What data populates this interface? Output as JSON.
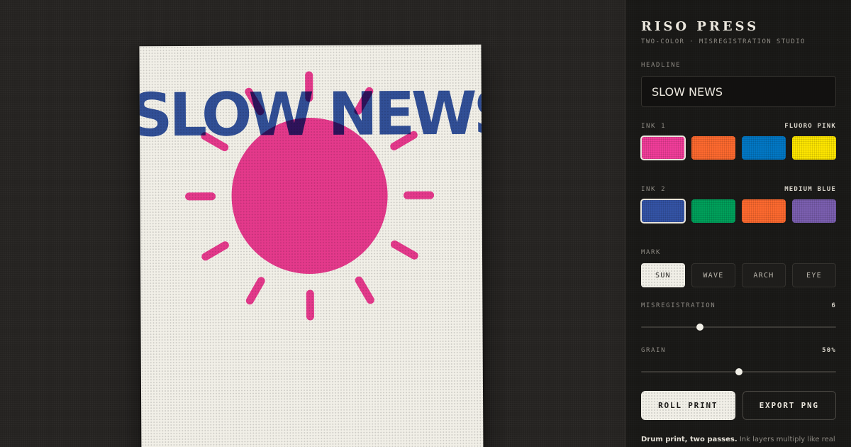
{
  "app": {
    "title": "RISO PRESS",
    "subtitle": "TWO-COLOR · MISREGISTRATION STUDIO"
  },
  "poster": {
    "headline_text": "SLOW NEWS",
    "mark_icon": "sun-icon"
  },
  "controls": {
    "headline": {
      "label": "HEADLINE",
      "value": "SLOW NEWS"
    },
    "ink1": {
      "label": "INK 1",
      "selected_name": "FLUORO PINK",
      "selected_index": 0,
      "swatches": [
        {
          "name": "fluoro-pink",
          "color": "#f23d9a"
        },
        {
          "name": "orange",
          "color": "#ff6a2f"
        },
        {
          "name": "blue",
          "color": "#0278c5"
        },
        {
          "name": "yellow",
          "color": "#ffe600"
        }
      ]
    },
    "ink2": {
      "label": "INK 2",
      "selected_name": "MEDIUM BLUE",
      "selected_index": 0,
      "swatches": [
        {
          "name": "medium-blue",
          "color": "#3454a6"
        },
        {
          "name": "green",
          "color": "#00a15b"
        },
        {
          "name": "orange",
          "color": "#ff6a2f"
        },
        {
          "name": "violet",
          "color": "#7b5fb0"
        }
      ]
    },
    "mark": {
      "label": "MARK",
      "active": "SUN",
      "options": [
        "SUN",
        "WAVE",
        "ARCH",
        "EYE"
      ]
    },
    "misregistration": {
      "label": "MISREGISTRATION",
      "value": 6,
      "display": "6",
      "min": 0,
      "max": 20
    },
    "grain": {
      "label": "GRAIN",
      "value": 50,
      "display": "50%",
      "min": 0,
      "max": 100
    },
    "roll_print_label": "ROLL PRINT",
    "export_label": "EXPORT PNG",
    "note_strong": "Drum print, two passes.",
    "note_text": " Ink layers multiply like real"
  }
}
